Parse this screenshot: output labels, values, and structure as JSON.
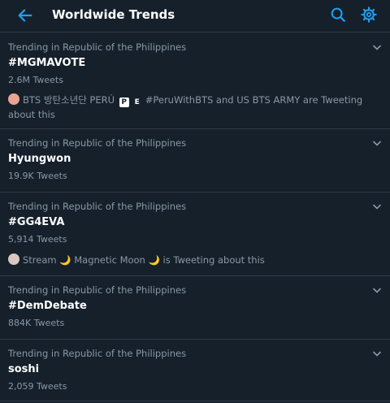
{
  "header": {
    "title": "Worldwide Trends"
  },
  "colors": {
    "background": "#15202b",
    "accent": "#1da1f2",
    "secondary_text": "#8899a6",
    "divider": "#2f3b47"
  },
  "icons": {
    "back": "arrow-left-icon",
    "search": "search-icon",
    "settings": "gear-icon",
    "more": "chevron-down-icon"
  },
  "trends": [
    {
      "context": "Trending in Republic of the Philippines",
      "name": "#MGMAVOTE",
      "count": "2.6M Tweets",
      "social": {
        "pre_text": "BTS 방탄소년단 PERÚ",
        "badge1": "P",
        "badge2": "E",
        "post_text": "#PeruWithBTS and US BTS ARMY are Tweeting about this"
      }
    },
    {
      "context": "Trending in Republic of the Philippines",
      "name": "Hyungwon",
      "count": "19.9K Tweets"
    },
    {
      "context": "Trending in Republic of the Philippines",
      "name": "#GG4EVA",
      "count": "5,914 Tweets",
      "social": {
        "text1": "Stream",
        "moon": "🌙",
        "text2": "Magnetic Moon",
        "text3": "is Tweeting about this"
      }
    },
    {
      "context": "Trending in Republic of the Philippines",
      "name": "#DemDebate",
      "count": "884K Tweets"
    },
    {
      "context": "Trending in Republic of the Philippines",
      "name": "soshi",
      "count": "2,059 Tweets"
    }
  ]
}
